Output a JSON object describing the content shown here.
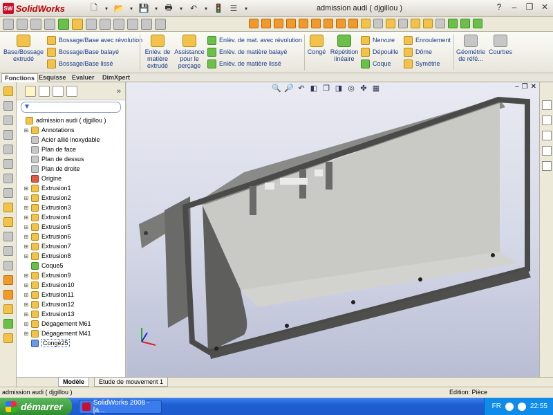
{
  "app": {
    "logo_badge": "SW",
    "logo_text": "SolidWorks",
    "document_title": "admission audi  ( djgillou )",
    "window_controls": [
      "?",
      "–",
      "❐",
      "✕"
    ]
  },
  "command_manager": {
    "features": {
      "boss_extrude": "Base/Bossage\nextrudé",
      "revolve": "Bossage/Base avec révolution",
      "sweep": "Bossage/Base balayé",
      "loft": "Bossage/Base lissé",
      "cut_extrude": "Enlèv. de\nmatière\nextrudé",
      "hole_wizard": "Assistance\npour le\nperçage",
      "cut_revolve": "Enlèv. de mat. avec révolution",
      "cut_sweep": "Enlèv. de matière balayé",
      "cut_loft": "Enlèv. de matière lissé",
      "fillet": "Congé",
      "linear_pattern": "Répétition\nlinéaire",
      "rib": "Nervure",
      "draft": "Dépouille",
      "shell": "Coque",
      "wrap": "Enroulement",
      "dome": "Dôme",
      "mirror": "Symétrie",
      "ref_geometry": "Géométrie\nde réfé...",
      "curves": "Courbes"
    },
    "tabs": [
      "Fonctions",
      "Esquisse",
      "Evaluer",
      "DimXpert"
    ],
    "active_tab": "Fonctions"
  },
  "feature_tree": {
    "root": "admission audi  ( djgillou )",
    "items": [
      {
        "label": "Annotations",
        "icon": "annotation-icon",
        "expandable": true
      },
      {
        "label": "Acier allié inoxydable",
        "icon": "material-icon",
        "expandable": false
      },
      {
        "label": "Plan de face",
        "icon": "plane-icon",
        "expandable": false
      },
      {
        "label": "Plan de dessus",
        "icon": "plane-icon",
        "expandable": false
      },
      {
        "label": "Plan de droite",
        "icon": "plane-icon",
        "expandable": false
      },
      {
        "label": "Origine",
        "icon": "origin-icon",
        "expandable": false
      },
      {
        "label": "Extrusion1",
        "icon": "extrude-icon",
        "expandable": true
      },
      {
        "label": "Extrusion2",
        "icon": "extrude-icon",
        "expandable": true
      },
      {
        "label": "Extrusion3",
        "icon": "extrude-icon",
        "expandable": true
      },
      {
        "label": "Extrusion4",
        "icon": "extrude-icon",
        "expandable": true
      },
      {
        "label": "Extrusion5",
        "icon": "extrude-icon",
        "expandable": true
      },
      {
        "label": "Extrusion6",
        "icon": "extrude-icon",
        "expandable": true
      },
      {
        "label": "Extrusion7",
        "icon": "extrude-icon",
        "expandable": true
      },
      {
        "label": "Extrusion8",
        "icon": "extrude-icon",
        "expandable": true
      },
      {
        "label": "Coque5",
        "icon": "shell-icon",
        "expandable": false
      },
      {
        "label": "Extrusion9",
        "icon": "extrude-icon",
        "expandable": true
      },
      {
        "label": "Extrusion10",
        "icon": "extrude-icon",
        "expandable": true
      },
      {
        "label": "Extrusion11",
        "icon": "extrude-icon",
        "expandable": true
      },
      {
        "label": "Extrusion12",
        "icon": "extrude-icon",
        "expandable": true
      },
      {
        "label": "Extrusion13",
        "icon": "extrude-icon",
        "expandable": true
      },
      {
        "label": "Dégagement M61",
        "icon": "hole-icon",
        "expandable": true
      },
      {
        "label": "Dégagement M41",
        "icon": "hole-icon",
        "expandable": true
      },
      {
        "label": "Congé25",
        "icon": "fillet-icon",
        "expandable": false,
        "selected": true
      }
    ]
  },
  "bottom_tabs": [
    "Modèle",
    "Etude de mouvement 1"
  ],
  "status": {
    "left": "admission audi  ( djgillou )",
    "right": "Edition: Pièce"
  },
  "taskbar": {
    "start": "démarrer",
    "task": "SolidWorks 2008 - [a...",
    "lang": "FR",
    "time": "22:55"
  },
  "colors": {
    "viewport_top": "#e9eaf2",
    "viewport_bottom": "#b9bdd4",
    "part_face": "#6e6e6e",
    "part_light": "#c9c9c6"
  }
}
